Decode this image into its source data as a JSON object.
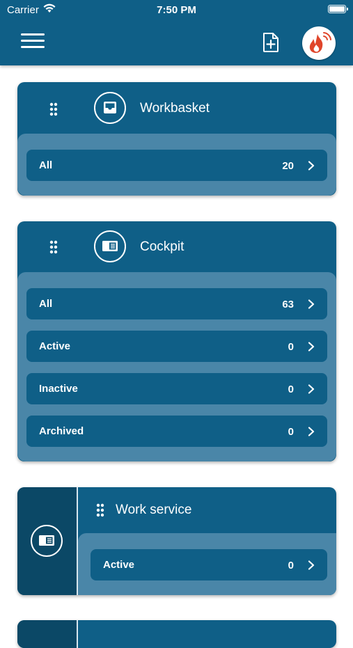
{
  "status": {
    "carrier": "Carrier",
    "time": "7:50 PM"
  },
  "header": {
    "menu_icon": "hamburger-icon",
    "new_icon": "new-document-icon",
    "avatar_icon": "fire-logo-icon"
  },
  "cards": {
    "workbasket": {
      "title": "Workbasket",
      "icon": "inbox-icon",
      "rows": [
        {
          "label": "All",
          "count": "20"
        }
      ]
    },
    "cockpit": {
      "title": "Cockpit",
      "icon": "dashboard-icon",
      "rows": [
        {
          "label": "All",
          "count": "63"
        },
        {
          "label": "Active",
          "count": "0"
        },
        {
          "label": "Inactive",
          "count": "0"
        },
        {
          "label": "Archived",
          "count": "0"
        }
      ]
    },
    "work_service": {
      "title": "Work service",
      "icon": "dashboard-icon",
      "rows": [
        {
          "label": "Active",
          "count": "0"
        }
      ]
    }
  },
  "colors": {
    "primary": "#0f5f87",
    "inner": "#4a86a8",
    "dark_panel": "#0b4866",
    "logo": "#e0452a"
  }
}
